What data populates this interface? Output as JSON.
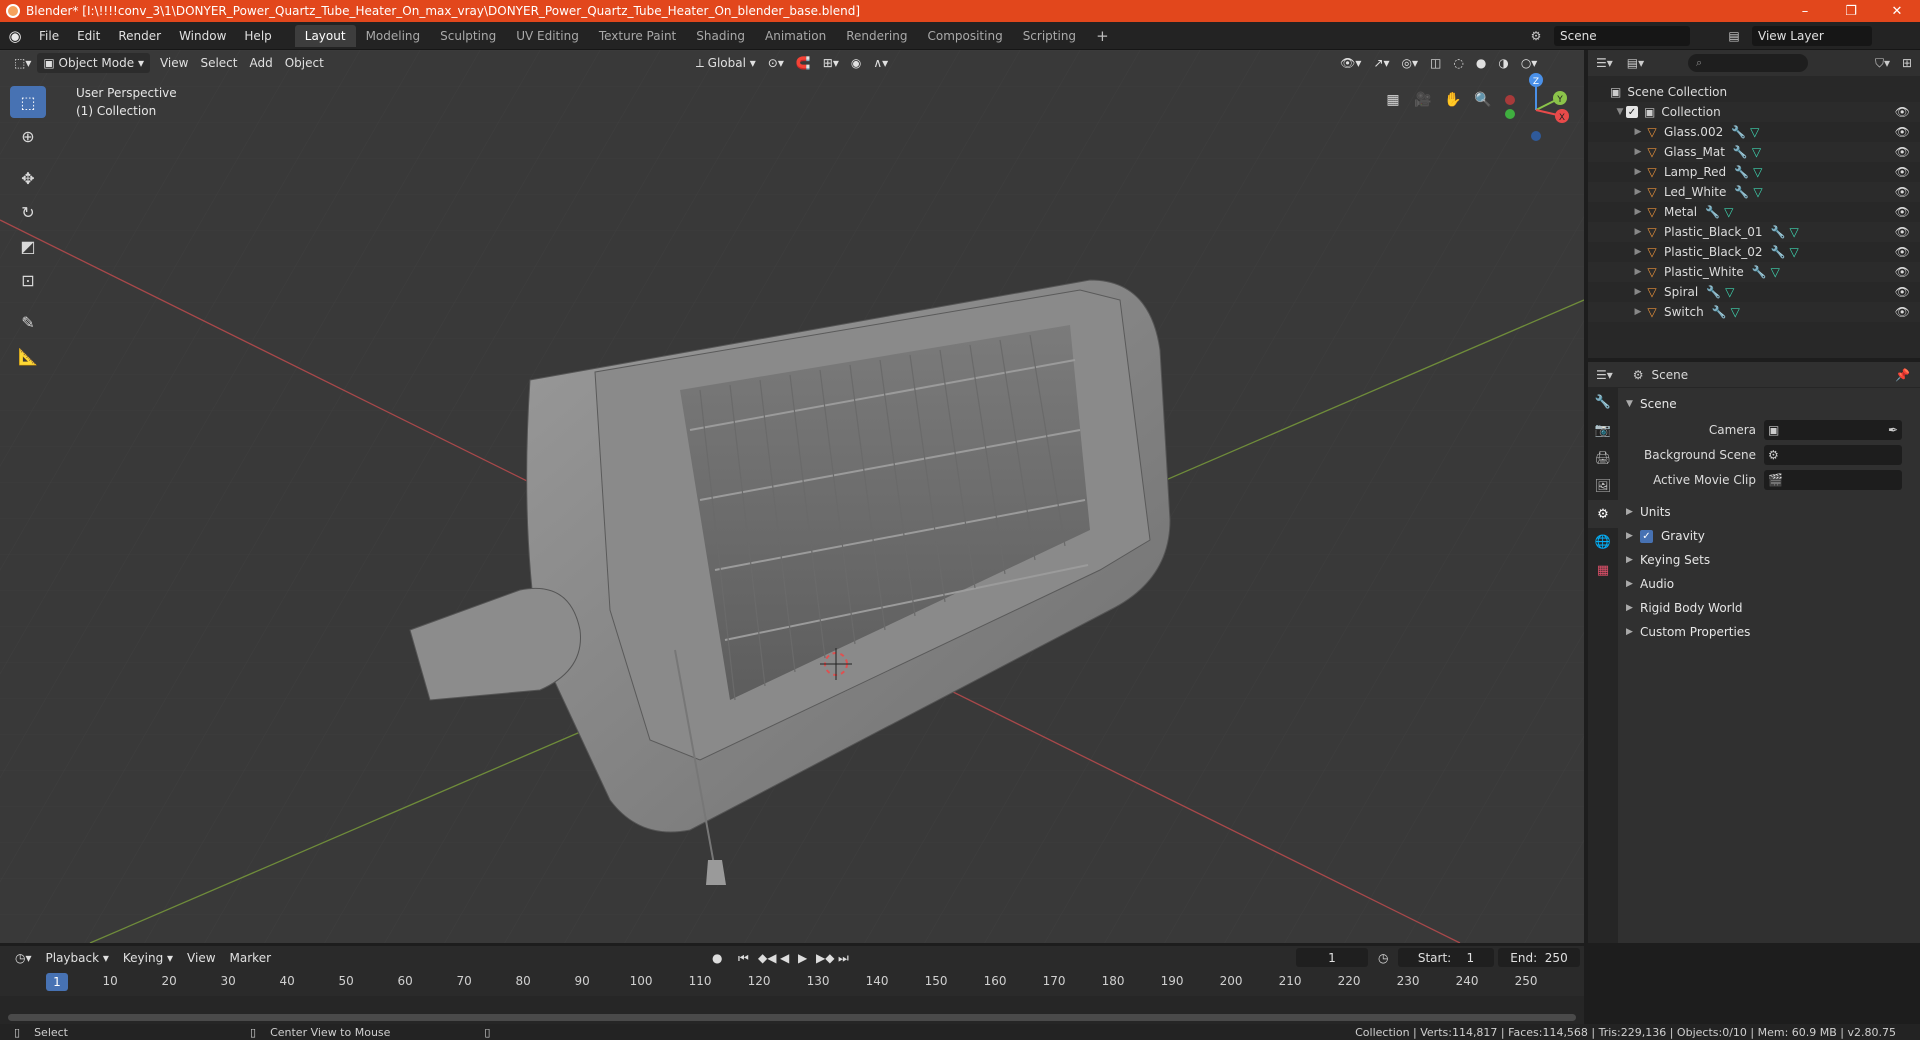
{
  "titlebar": {
    "title": "Blender* [I:\\!!!!conv_3\\1\\DONYER_Power_Quartz_Tube_Heater_On_max_vray\\DONYER_Power_Quartz_Tube_Heater_On_blender_base.blend]",
    "minimize": "–",
    "maximize": "❐",
    "close": "✕"
  },
  "menu": {
    "items": [
      "File",
      "Edit",
      "Render",
      "Window",
      "Help"
    ],
    "workspaces": [
      "Layout",
      "Modeling",
      "Sculpting",
      "UV Editing",
      "Texture Paint",
      "Shading",
      "Animation",
      "Rendering",
      "Compositing",
      "Scripting"
    ],
    "add_workspace": "+",
    "scene": "Scene",
    "view_layer": "View Layer"
  },
  "viewport": {
    "mode": "Object Mode",
    "menus": [
      "View",
      "Select",
      "Add",
      "Object"
    ],
    "orientation": "Global",
    "perspective": "User Perspective",
    "collection_label": "(1) Collection",
    "gizmo_axes": {
      "x": "X",
      "y": "Y",
      "z": "Z"
    }
  },
  "outliner": {
    "search_placeholder": "",
    "scene_collection": "Scene Collection",
    "collection": "Collection",
    "objects": [
      "Glass.002",
      "Glass_Mat",
      "Lamp_Red",
      "Led_White",
      "Metal",
      "Plastic_Black_01",
      "Plastic_Black_02",
      "Plastic_White",
      "Spiral",
      "Switch"
    ]
  },
  "properties": {
    "header_title": "Scene",
    "panel_title": "Scene",
    "camera_label": "Camera",
    "background_scene_label": "Background Scene",
    "active_movie_clip_label": "Active Movie Clip",
    "subpanels": [
      "Units",
      "Gravity",
      "Keying Sets",
      "Audio",
      "Rigid Body World",
      "Custom Properties"
    ],
    "gravity_enabled": true
  },
  "timeline": {
    "menus": [
      "Playback",
      "Keying",
      "View",
      "Marker"
    ],
    "current_frame": "1",
    "start_label": "Start:",
    "start": "1",
    "end_label": "End:",
    "end": "250",
    "ruler_ticks": [
      "1",
      "10",
      "20",
      "30",
      "40",
      "50",
      "60",
      "70",
      "80",
      "90",
      "100",
      "110",
      "120",
      "130",
      "140",
      "150",
      "160",
      "170",
      "180",
      "190",
      "200",
      "210",
      "220",
      "230",
      "240",
      "250"
    ]
  },
  "statusbar": {
    "select": "Select",
    "center_view": "Center View to Mouse",
    "stats": "Collection | Verts:114,817 | Faces:114,568 | Tris:229,136 | Objects:0/10 | Mem: 60.9 MB | v2.80.75"
  },
  "colors": {
    "titlebar": "#e2471c",
    "accent": "#4772b3",
    "object_icon": "#e8913a",
    "modifier_icon": "#7aa4e8",
    "mesh_icon": "#3fd6b1",
    "x_axis": "#e84a4a",
    "y_axis": "#8bc34a",
    "z_axis": "#4a90e8"
  }
}
